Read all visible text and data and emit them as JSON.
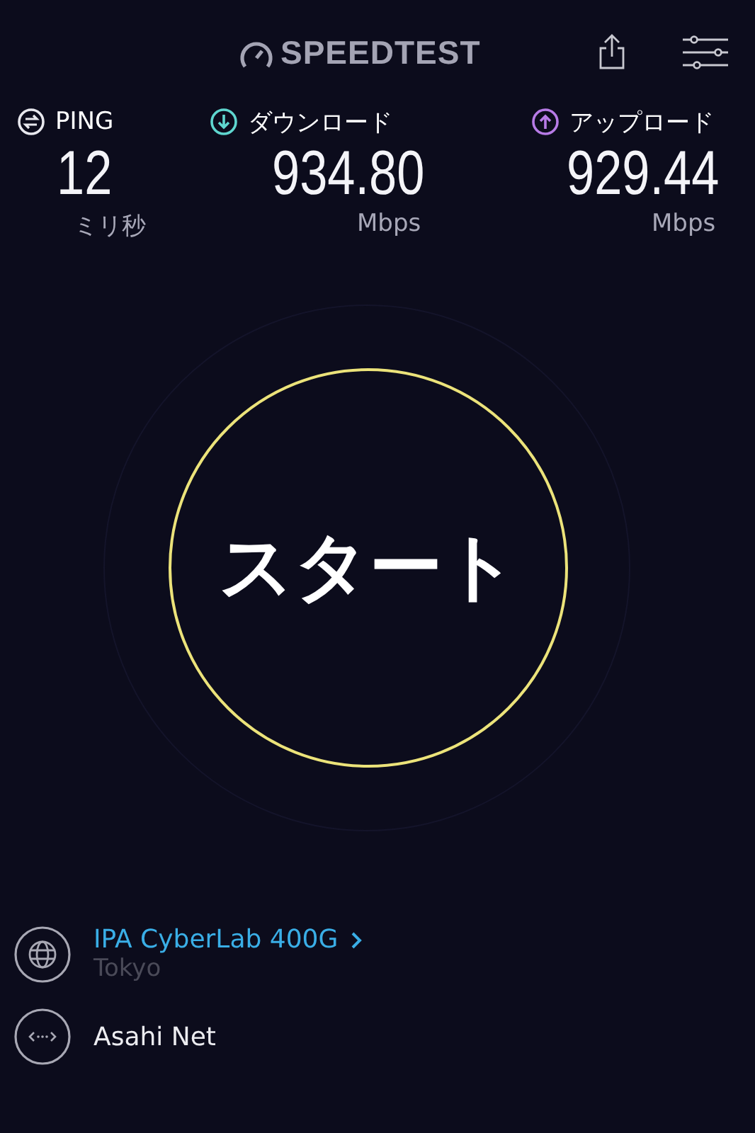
{
  "header": {
    "logo": "SPEEDTEST"
  },
  "metrics": [
    {
      "kind": "ping",
      "label": "PING",
      "value": "12",
      "unit": "ミリ秒"
    },
    {
      "kind": "download",
      "label": "ダウンロード",
      "value": "934.80",
      "unit": "Mbps"
    },
    {
      "kind": "upload",
      "label": "アップロード",
      "value": "929.44",
      "unit": "Mbps"
    }
  ],
  "start_button": {
    "label": "スタート"
  },
  "server": {
    "name": "IPA CyberLab 400G",
    "location": "Tokyo"
  },
  "provider": {
    "name": "Asahi Net"
  }
}
